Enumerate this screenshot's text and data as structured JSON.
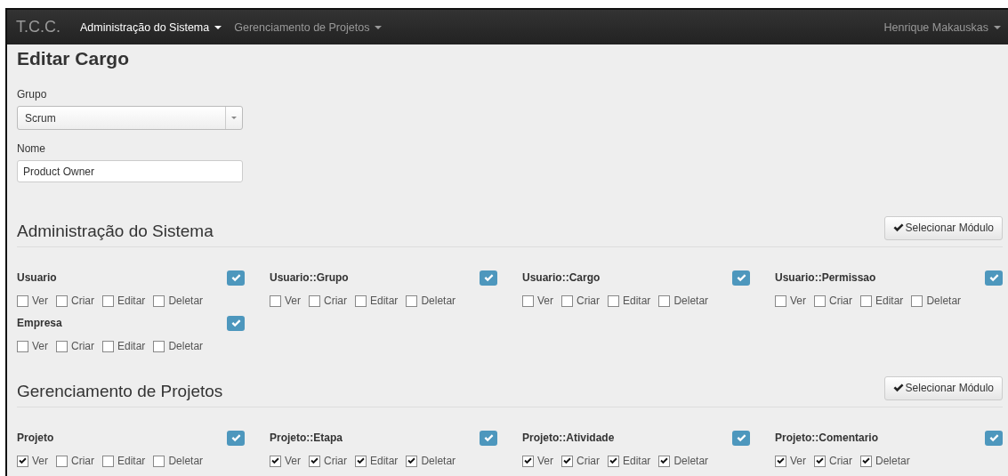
{
  "navbar": {
    "brand": "T.C.C.",
    "menus": [
      {
        "label": "Administração do Sistema",
        "selected": true
      },
      {
        "label": "Gerenciamento de Projetos",
        "selected": false
      }
    ],
    "user": "Henrique Makauskas"
  },
  "title": "Editar Cargo",
  "form": {
    "grupo": {
      "label": "Grupo",
      "value": "Scrum"
    },
    "nome": {
      "label": "Nome",
      "value": "Product Owner"
    }
  },
  "sections": [
    {
      "heading": "Administração do Sistema",
      "button": "Selecionar Módulo",
      "modules": [
        {
          "name": "Usuario",
          "checked": true,
          "permissions": [
            {
              "label": "Ver",
              "checked": false
            },
            {
              "label": "Criar",
              "checked": false
            },
            {
              "label": "Editar",
              "checked": false
            },
            {
              "label": "Deletar",
              "checked": false
            }
          ]
        },
        {
          "name": "Usuario::Grupo",
          "checked": true,
          "permissions": [
            {
              "label": "Ver",
              "checked": false
            },
            {
              "label": "Criar",
              "checked": false
            },
            {
              "label": "Editar",
              "checked": false
            },
            {
              "label": "Deletar",
              "checked": false
            }
          ]
        },
        {
          "name": "Usuario::Cargo",
          "checked": true,
          "permissions": [
            {
              "label": "Ver",
              "checked": false
            },
            {
              "label": "Criar",
              "checked": false
            },
            {
              "label": "Editar",
              "checked": false
            },
            {
              "label": "Deletar",
              "checked": false
            }
          ]
        },
        {
          "name": "Usuario::Permissao",
          "checked": true,
          "permissions": [
            {
              "label": "Ver",
              "checked": false
            },
            {
              "label": "Criar",
              "checked": false
            },
            {
              "label": "Editar",
              "checked": false
            },
            {
              "label": "Deletar",
              "checked": false
            }
          ]
        },
        {
          "name": "Empresa",
          "checked": true,
          "permissions": [
            {
              "label": "Ver",
              "checked": false
            },
            {
              "label": "Criar",
              "checked": false
            },
            {
              "label": "Editar",
              "checked": false
            },
            {
              "label": "Deletar",
              "checked": false
            }
          ]
        }
      ]
    },
    {
      "heading": "Gerenciamento de Projetos",
      "button": "Selecionar Módulo",
      "modules": [
        {
          "name": "Projeto",
          "checked": true,
          "permissions": [
            {
              "label": "Ver",
              "checked": true
            },
            {
              "label": "Criar",
              "checked": false
            },
            {
              "label": "Editar",
              "checked": false
            },
            {
              "label": "Deletar",
              "checked": false
            }
          ]
        },
        {
          "name": "Projeto::Etapa",
          "checked": true,
          "permissions": [
            {
              "label": "Ver",
              "checked": true
            },
            {
              "label": "Criar",
              "checked": true
            },
            {
              "label": "Editar",
              "checked": true
            },
            {
              "label": "Deletar",
              "checked": true
            }
          ]
        },
        {
          "name": "Projeto::Atividade",
          "checked": true,
          "permissions": [
            {
              "label": "Ver",
              "checked": true
            },
            {
              "label": "Criar",
              "checked": true
            },
            {
              "label": "Editar",
              "checked": true
            },
            {
              "label": "Deletar",
              "checked": true
            }
          ]
        },
        {
          "name": "Projeto::Comentario",
          "checked": true,
          "permissions": [
            {
              "label": "Ver",
              "checked": true
            },
            {
              "label": "Criar",
              "checked": true
            },
            {
              "label": "Deletar",
              "checked": true
            }
          ]
        }
      ]
    }
  ]
}
